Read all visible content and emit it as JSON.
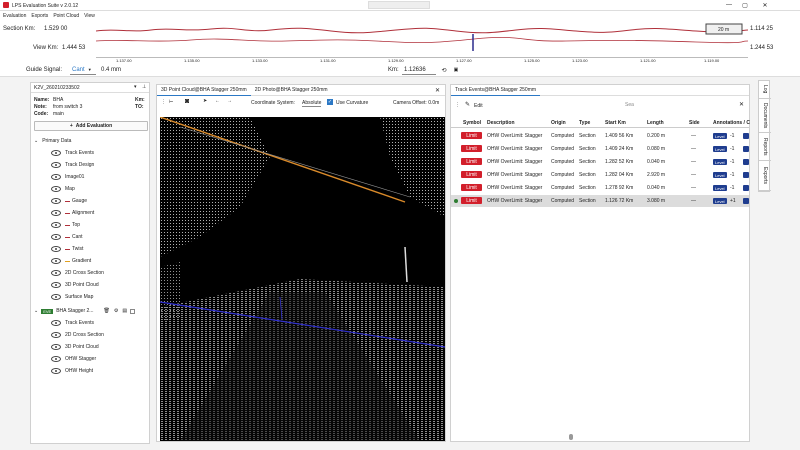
{
  "app": {
    "title": "LPS Evaluation Suite v 2.0.12"
  },
  "menu": [
    "Evaluation",
    "Exports",
    "Point Cloud",
    "View"
  ],
  "ruler": {
    "section_km_label": "Section Km:",
    "section_km_start": "1.529 00",
    "section_km_end": "1.114 25",
    "view_km_label": "View Km:",
    "view_km_start": "1.444 53",
    "view_km_end": "1.244 53",
    "range_badge": "20 m",
    "ticks": [
      "1.137.00",
      "1.135.00",
      "1.133.00",
      "1.131.00",
      "1.129.00",
      "1.127.00",
      "1.125.00",
      "1.123.00",
      "1.121.00",
      "1.119.00"
    ],
    "slider_label": "Stop"
  },
  "guide": {
    "label": "Guide Signal:",
    "signal": "Cant",
    "value": "0.4 mm",
    "km_label": "Km:",
    "km_value": "1.12636"
  },
  "left_panel": {
    "title": "K2V_260210233502",
    "name_label": "Name:",
    "name_value": "BHA",
    "note_label": "Note:",
    "note_value": "from switch 3",
    "code_label": "Code:",
    "code_value": "main",
    "km_label": "Km:",
    "to_label": "TO:",
    "add_button": "Add Evaluation",
    "primary_group": "Primary Data",
    "primary_items": [
      "Track Events",
      "Track Design",
      "Image01",
      "Map",
      "Gauge",
      "Alignment",
      "Top",
      "Cant",
      "Twist",
      "Gradient",
      "2D Cross Section",
      "3D Point Cloud",
      "Surface Map"
    ],
    "eval_badge": "EVE",
    "eval_name": "BHA Stagger 2...",
    "eval_items": [
      "Track Events",
      "2D Cross Section",
      "3D Point Cloud",
      "OHW Stagger",
      "OHW Height"
    ]
  },
  "center": {
    "tabs": [
      "3D Point Cloud@BHA Stagger 250mm",
      "2D Photo@BHA Stagger 250mm"
    ],
    "coord_label": "Coordinate System:",
    "coord_value": "Absolute",
    "curvature_label": "Use Curvature",
    "offset_label": "Camera Offset: 0.0m"
  },
  "events": {
    "tab": "Track Events@BHA Stagger 250mm",
    "edit_label": "Edit",
    "search_placeholder": "Sea",
    "columns": [
      "Symbol",
      "Description",
      "Origin",
      "Type",
      "Start Km",
      "Length",
      "Side",
      "Annotations / C"
    ],
    "rows": [
      {
        "symbol": "Limit",
        "description": "OHW OverLimit: Stagger",
        "origin": "Computed",
        "type": "Section",
        "start_km": "1.409 56 Km",
        "length": "0.200 m",
        "side": "—",
        "level": "Level",
        "count": "-1"
      },
      {
        "symbol": "Limit",
        "description": "OHW OverLimit: Stagger",
        "origin": "Computed",
        "type": "Section",
        "start_km": "1.409 24 Km",
        "length": "0.080 m",
        "side": "—",
        "level": "Level",
        "count": "-1"
      },
      {
        "symbol": "Limit",
        "description": "OHW OverLimit: Stagger",
        "origin": "Computed",
        "type": "Section",
        "start_km": "1.282 52 Km",
        "length": "0.040 m",
        "side": "—",
        "level": "Level",
        "count": "-1"
      },
      {
        "symbol": "Limit",
        "description": "OHW OverLimit: Stagger",
        "origin": "Computed",
        "type": "Section",
        "start_km": "1.282 04 Km",
        "length": "2.920 m",
        "side": "—",
        "level": "Level",
        "count": "-1"
      },
      {
        "symbol": "Limit",
        "description": "OHW OverLimit: Stagger",
        "origin": "Computed",
        "type": "Section",
        "start_km": "1.278 92 Km",
        "length": "0.040 m",
        "side": "—",
        "level": "Level",
        "count": "-1"
      },
      {
        "symbol": "Limit",
        "description": "OHW OverLimit: Stagger",
        "origin": "Computed",
        "type": "Section",
        "start_km": "1.126 72 Km",
        "length": "3.080 m",
        "side": "—",
        "level": "Level",
        "count": "+1"
      }
    ]
  },
  "side_tabs": [
    "Log",
    "Documents",
    "Reports",
    "Exports"
  ],
  "colors": {
    "limit": "#d21f2b",
    "level": "#1f3d8f",
    "accent": "#2b78c5",
    "curve": "#b0303a"
  }
}
